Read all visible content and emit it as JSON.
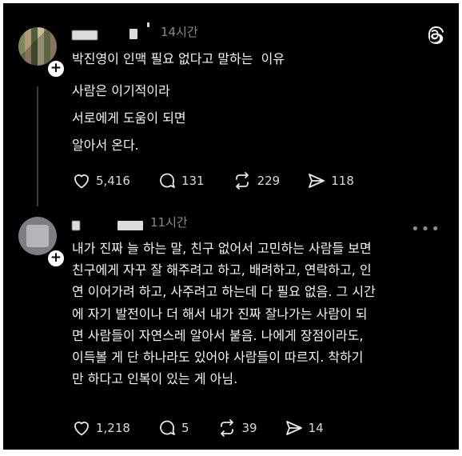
{
  "post1": {
    "time": "14시간",
    "title": "박진영이 인맥 필요 없다고 말하는  이유",
    "lines": [
      "사람은 이기적이라",
      "서로에게 도움이 되면",
      "알아서 온다."
    ],
    "likes": "5,416",
    "comments": "131",
    "reposts": "229",
    "shares": "118"
  },
  "post2": {
    "time": "11시간",
    "lines": [
      "내가 진짜 늘 하는 말, 친구 없어서 고민하는 사람들 보면",
      "친구에게 자꾸 잘 해주려고 하고, 배려하고, 연락하고, 인",
      "연 이어가려 하고, 사주려고 하는데 다 필요 없음. 그 시간",
      "에 자기 발전이나 더 해서 내가 진짜 잘나가는 사람이 되",
      "면 사람들이 자연스레 알아서 붙음. 나에게 장점이라도,",
      "이득볼 게 단 하나라도 있어야 사람들이 따르지. 착하기",
      "만 하다고 인복이 있는 게 아님."
    ],
    "likes": "1,218",
    "comments": "5",
    "reposts": "39",
    "shares": "14"
  },
  "plus_symbol": "+",
  "more_symbol": "•••",
  "icons": {
    "like": "heart-icon",
    "comment": "comment-bubble-icon",
    "repost": "repost-icon",
    "share": "send-icon",
    "logo": "threads-logo-icon"
  }
}
